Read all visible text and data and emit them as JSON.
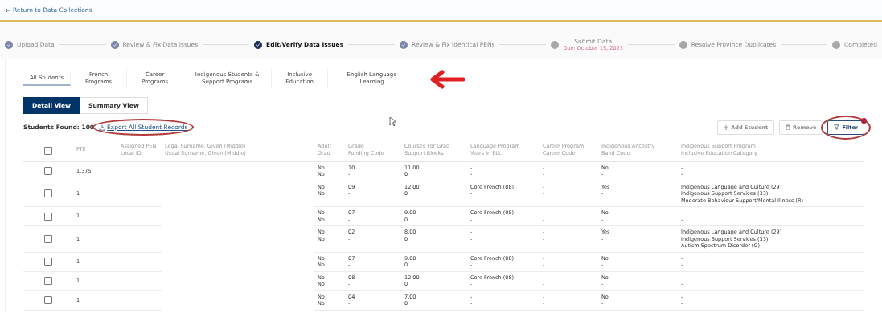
{
  "back_link": "Return to Data Collections",
  "steps": [
    {
      "label": "Upload Data",
      "completed": true,
      "selected": false
    },
    {
      "label": "Review & Fix Data Issues",
      "completed": true,
      "selected": false
    },
    {
      "label": "Edit/Verify Data Issues",
      "completed": true,
      "selected": true
    },
    {
      "label": "Review & Fix Identical PENs",
      "completed": true,
      "selected": false
    },
    {
      "label": "Submit Data",
      "completed": false,
      "selected": false,
      "note": "Due: October 15, 2023"
    },
    {
      "label": "Resolve Province Duplicates",
      "completed": false,
      "selected": false
    },
    {
      "label": "Completed",
      "completed": false,
      "selected": false
    }
  ],
  "category_tabs": [
    {
      "label": "All Students",
      "selected": true
    },
    {
      "label": "French Programs",
      "selected": false
    },
    {
      "label": "Career Programs",
      "selected": false
    },
    {
      "label": "Indigenous Students & Support Programs",
      "selected": false
    },
    {
      "label": "Inclusive Education",
      "selected": false
    },
    {
      "label": "English Language Learning",
      "selected": false
    }
  ],
  "tabs_arrowed": true,
  "view_tabs": [
    {
      "label": "Detail View",
      "selected": true
    },
    {
      "label": "Summary View",
      "selected": false
    }
  ],
  "students_found": {
    "label": "Students Found:",
    "count": "100"
  },
  "export_link": {
    "label": "Export All Student Records",
    "circled": true
  },
  "actions": [
    {
      "label": "Add Student",
      "disabled": true,
      "circled": false
    },
    {
      "label": "Remove",
      "disabled": true,
      "circled": false
    },
    {
      "label": "Filter",
      "disabled": false,
      "circled": true
    }
  ],
  "table": {
    "select_all": {
      "checked": false
    },
    "columns": [
      {
        "lines": [
          "FTE"
        ]
      },
      {
        "lines": [
          "Assigned PEN",
          "Local ID"
        ]
      },
      {
        "lines": [
          "Legal Surname, Given (Middle)",
          "Usual Surname, Given (Middle)"
        ]
      },
      {
        "lines": [
          "Adult",
          "Grad"
        ]
      },
      {
        "lines": [
          "Grade",
          "Funding Code"
        ]
      },
      {
        "lines": [
          "Courses For Grad",
          "Support Blocks"
        ]
      },
      {
        "lines": [
          "Language Program",
          "Years in ELL"
        ]
      },
      {
        "lines": [
          "Career Program",
          "Career Code"
        ]
      },
      {
        "lines": [
          "Indigenous Ancestry",
          "Band Code"
        ]
      },
      {
        "lines": [
          "Indigenous Support Program",
          "Inclusive Education Category"
        ]
      }
    ],
    "rows": [
      {
        "selected": false,
        "cells": [
          [
            "1.375"
          ],
          [
            ""
          ],
          [
            ""
          ],
          [
            "No",
            "No"
          ],
          [
            "10",
            "-"
          ],
          [
            "11.00",
            "0"
          ],
          [
            "-",
            "-"
          ],
          [
            "-",
            "-"
          ],
          [
            "No",
            "-"
          ],
          [
            "-",
            "-"
          ]
        ]
      },
      {
        "selected": false,
        "cells": [
          [
            "1"
          ],
          [
            ""
          ],
          [
            ""
          ],
          [
            "No",
            "No"
          ],
          [
            "09",
            "-"
          ],
          [
            "12.00",
            "0"
          ],
          [
            "Core French (08)",
            "-"
          ],
          [
            "-",
            "-"
          ],
          [
            "Yes",
            "-"
          ],
          [
            "Indigenous Language and Culture (29)",
            "Indigenous Support Services (33)",
            "Moderate Behaviour Support/Mental Illness (R)"
          ]
        ]
      },
      {
        "selected": false,
        "cells": [
          [
            "1"
          ],
          [
            ""
          ],
          [
            ""
          ],
          [
            "No",
            "No"
          ],
          [
            "07",
            "-"
          ],
          [
            "9.00",
            "0"
          ],
          [
            "Core French (08)",
            "-"
          ],
          [
            "-",
            "-"
          ],
          [
            "No",
            "-"
          ],
          [
            "-",
            "-"
          ]
        ]
      },
      {
        "selected": false,
        "cells": [
          [
            "1"
          ],
          [
            ""
          ],
          [
            ""
          ],
          [
            "No",
            "No"
          ],
          [
            "02",
            "-"
          ],
          [
            "8.00",
            "0"
          ],
          [
            "-",
            "-"
          ],
          [
            "-",
            "-"
          ],
          [
            "Yes",
            "-"
          ],
          [
            "Indigenous Language and Culture (29)",
            "Indigenous Support Services (33)",
            "Autism Spectrum Disorder (G)"
          ]
        ]
      },
      {
        "selected": false,
        "cells": [
          [
            "1"
          ],
          [
            ""
          ],
          [
            ""
          ],
          [
            "No",
            "No"
          ],
          [
            "07",
            "-"
          ],
          [
            "9.00",
            "0"
          ],
          [
            "Core French (08)",
            "-"
          ],
          [
            "-",
            "-"
          ],
          [
            "No",
            "-"
          ],
          [
            "-",
            "-"
          ]
        ]
      },
      {
        "selected": false,
        "cells": [
          [
            "1"
          ],
          [
            ""
          ],
          [
            ""
          ],
          [
            "No",
            "No"
          ],
          [
            "08",
            "-"
          ],
          [
            "12.00",
            "0"
          ],
          [
            "Core French (08)",
            "-"
          ],
          [
            "-",
            "-"
          ],
          [
            "No",
            "-"
          ],
          [
            "-",
            "-"
          ]
        ]
      },
      {
        "selected": false,
        "cells": [
          [
            "1"
          ],
          [
            ""
          ],
          [
            ""
          ],
          [
            "No",
            "No"
          ],
          [
            "04",
            "-"
          ],
          [
            "7.00",
            "0"
          ],
          [
            "-",
            "-"
          ],
          [
            "-",
            "-"
          ],
          [
            "No",
            "-"
          ],
          [
            "-",
            "-"
          ]
        ]
      }
    ]
  }
}
